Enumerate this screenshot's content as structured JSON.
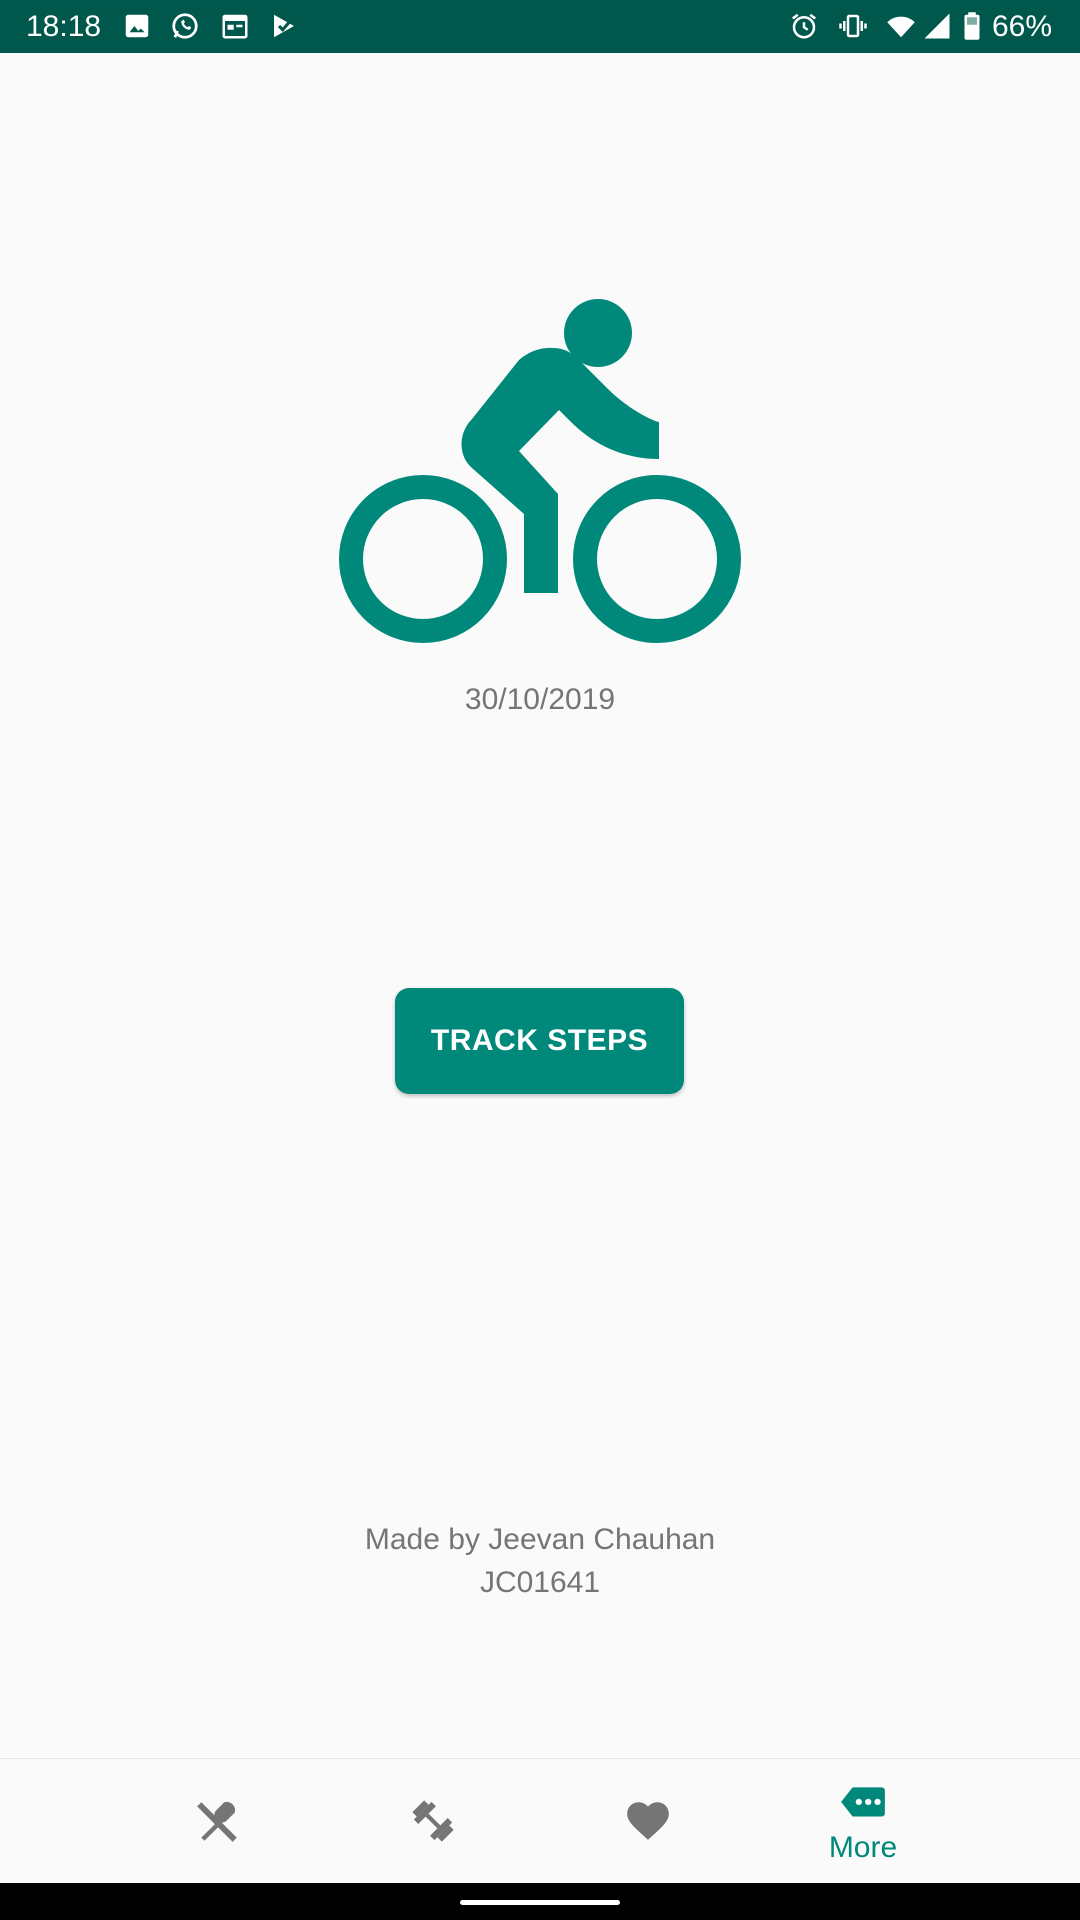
{
  "status_bar": {
    "time": "18:18",
    "battery_percent": "66%",
    "background_color": "#00574b",
    "left_icons": [
      "image-icon",
      "whatsapp-icon",
      "calendar-icon",
      "play-check-icon"
    ],
    "right_icons": [
      "alarm-icon",
      "vibrate-icon",
      "wifi-icon",
      "signal-icon",
      "battery-icon"
    ]
  },
  "main": {
    "hero_icon": "bike-icon",
    "date": "30/10/2019",
    "track_button_label": "TRACK STEPS",
    "credit_line1": "Made by Jeevan Chauhan",
    "credit_line2": "JC01641"
  },
  "bottom_nav": {
    "items": [
      {
        "icon": "food-icon",
        "label": "",
        "active": false
      },
      {
        "icon": "dumbbell-icon",
        "label": "",
        "active": false
      },
      {
        "icon": "heart-icon",
        "label": "",
        "active": false
      },
      {
        "icon": "more-icon",
        "label": "More",
        "active": true
      }
    ]
  },
  "colors": {
    "accent": "#00897b",
    "status_bar": "#00574b",
    "inactive_icon": "#757575",
    "text_secondary": "#757575"
  }
}
